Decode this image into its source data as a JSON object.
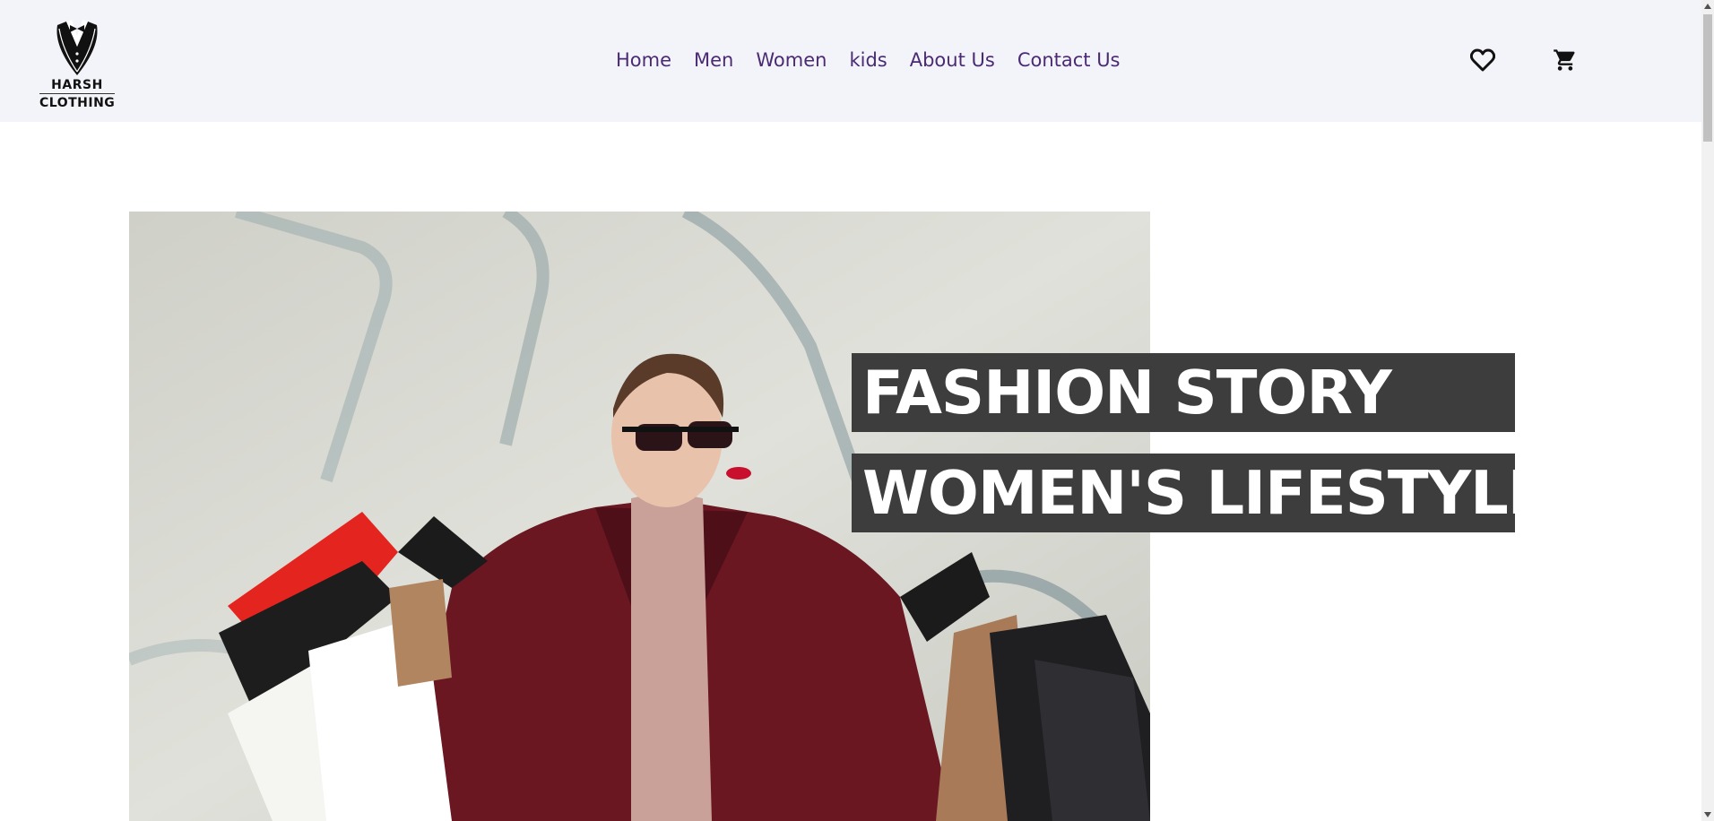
{
  "header": {
    "logo": {
      "line1": "HARSH",
      "line2": "CLOTHING"
    },
    "nav": [
      {
        "label": "Home"
      },
      {
        "label": "Men"
      },
      {
        "label": "Women"
      },
      {
        "label": "kids"
      },
      {
        "label": "About Us"
      },
      {
        "label": "Contact Us"
      }
    ],
    "icons": {
      "wishlist": "heart-icon",
      "cart": "cart-icon"
    }
  },
  "hero": {
    "title_line1": "FASHION STORY",
    "title_line2": "WOMEN'S LIFESTYLE"
  },
  "colors": {
    "header_bg": "#f3f4f9",
    "nav_text": "#4a2a73",
    "title_bg": "#3d3d3d",
    "title_text": "#ffffff"
  }
}
